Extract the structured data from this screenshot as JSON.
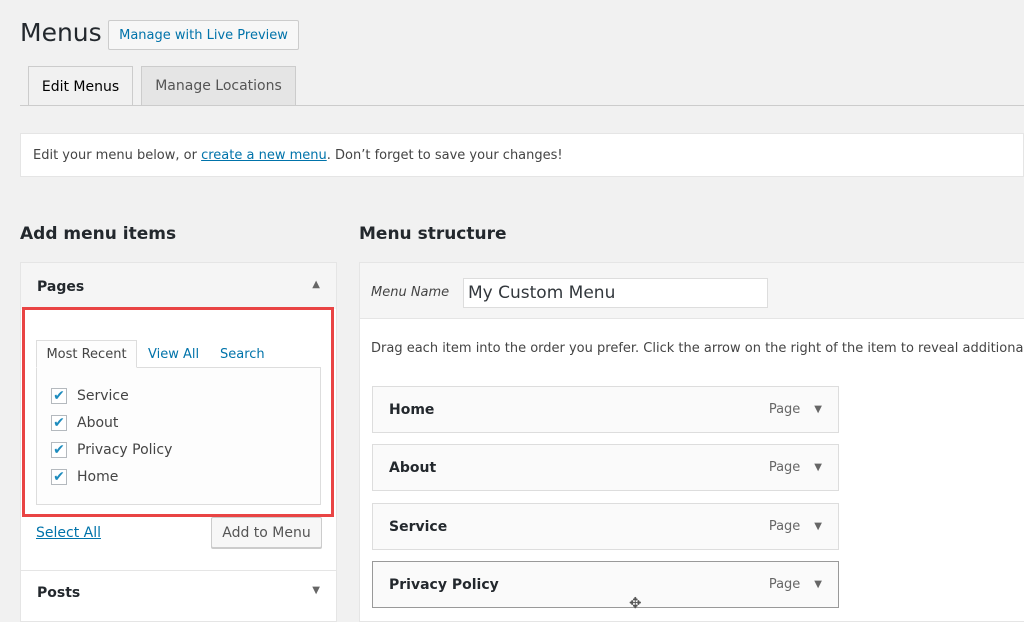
{
  "header": {
    "title": "Menus",
    "live_preview": "Manage with Live Preview"
  },
  "tabs": [
    {
      "label": "Edit Menus",
      "active": true
    },
    {
      "label": "Manage Locations",
      "active": false
    }
  ],
  "notice": {
    "before": "Edit your menu below, or ",
    "link": "create a new menu",
    "after": ". Don’t forget to save your changes!"
  },
  "add_items": {
    "heading": "Add menu items",
    "pages": {
      "title": "Pages",
      "tabs": [
        "Most Recent",
        "View All",
        "Search"
      ],
      "items": [
        {
          "label": "Service",
          "checked": true
        },
        {
          "label": "About",
          "checked": true
        },
        {
          "label": "Privacy Policy",
          "checked": true
        },
        {
          "label": "Home",
          "checked": true
        }
      ],
      "select_all": "Select All",
      "add_button": "Add to Menu"
    },
    "posts": {
      "title": "Posts"
    }
  },
  "structure": {
    "heading": "Menu structure",
    "menu_name_label": "Menu Name",
    "menu_name_value": "My Custom Menu",
    "instructions": "Drag each item into the order you prefer. Click the arrow on the right of the item to reveal additional",
    "items": [
      {
        "label": "Home",
        "type": "Page"
      },
      {
        "label": "About",
        "type": "Page"
      },
      {
        "label": "Service",
        "type": "Page"
      },
      {
        "label": "Privacy Policy",
        "type": "Page"
      }
    ]
  },
  "colors": {
    "link": "#0073aa",
    "highlight": "#e94444",
    "check": "#1e8cbe"
  }
}
